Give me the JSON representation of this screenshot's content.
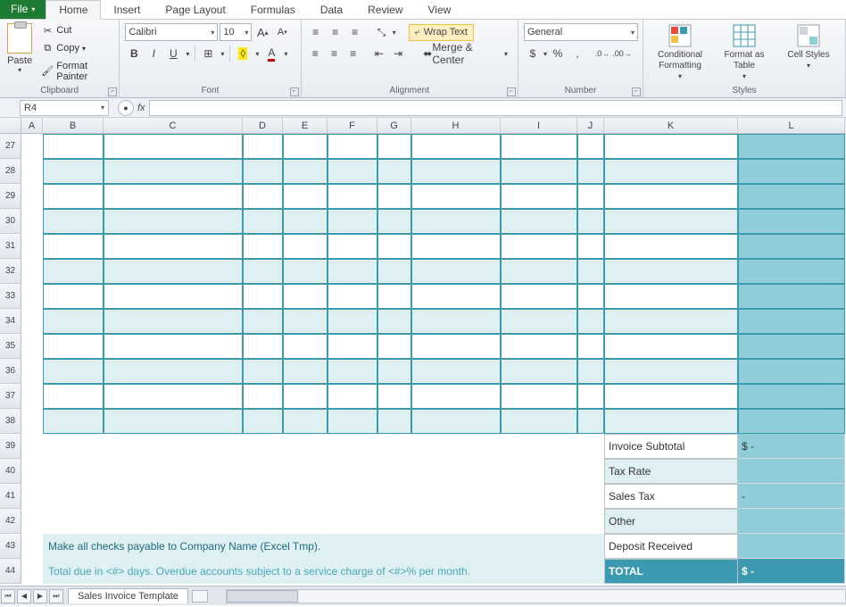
{
  "tabs": {
    "file": "File",
    "home": "Home",
    "insert": "Insert",
    "pagelayout": "Page Layout",
    "formulas": "Formulas",
    "data": "Data",
    "review": "Review",
    "view": "View"
  },
  "clipboard": {
    "paste": "Paste",
    "cut": "Cut",
    "copy": "Copy",
    "fmtpainter": "Format Painter",
    "group": "Clipboard"
  },
  "font": {
    "name": "Calibri",
    "size": "10",
    "group": "Font"
  },
  "alignment": {
    "wrap": "Wrap Text",
    "merge": "Merge & Center",
    "group": "Alignment"
  },
  "number": {
    "format": "General",
    "group": "Number"
  },
  "styles": {
    "cond": "Conditional Formatting",
    "table": "Format as Table",
    "cell": "Cell Styles",
    "group": "Styles"
  },
  "namebox": "R4",
  "fx": "fx",
  "columns": [
    "A",
    "B",
    "C",
    "D",
    "E",
    "F",
    "G",
    "H",
    "I",
    "J",
    "K",
    "L"
  ],
  "rows": [
    "27",
    "28",
    "29",
    "30",
    "31",
    "32",
    "33",
    "34",
    "35",
    "36",
    "37",
    "38",
    "39",
    "40",
    "41",
    "42",
    "43",
    "44"
  ],
  "summary": {
    "subtotal": "Invoice Subtotal",
    "subtotal_v": "$                     -",
    "taxrate": "Tax Rate",
    "taxrate_v": "",
    "salestax": "Sales Tax",
    "salestax_v": "-",
    "other": "Other",
    "other_v": "",
    "deposit": "Deposit Received",
    "deposit_v": "",
    "total": "TOTAL",
    "total_v": "$                     -"
  },
  "notes": {
    "line1": "Make all checks payable to Company Name (Excel Tmp).",
    "line2": "Total due in <#> days. Overdue accounts subject to a service charge of <#>% per month."
  },
  "sheet": "Sales Invoice Template"
}
